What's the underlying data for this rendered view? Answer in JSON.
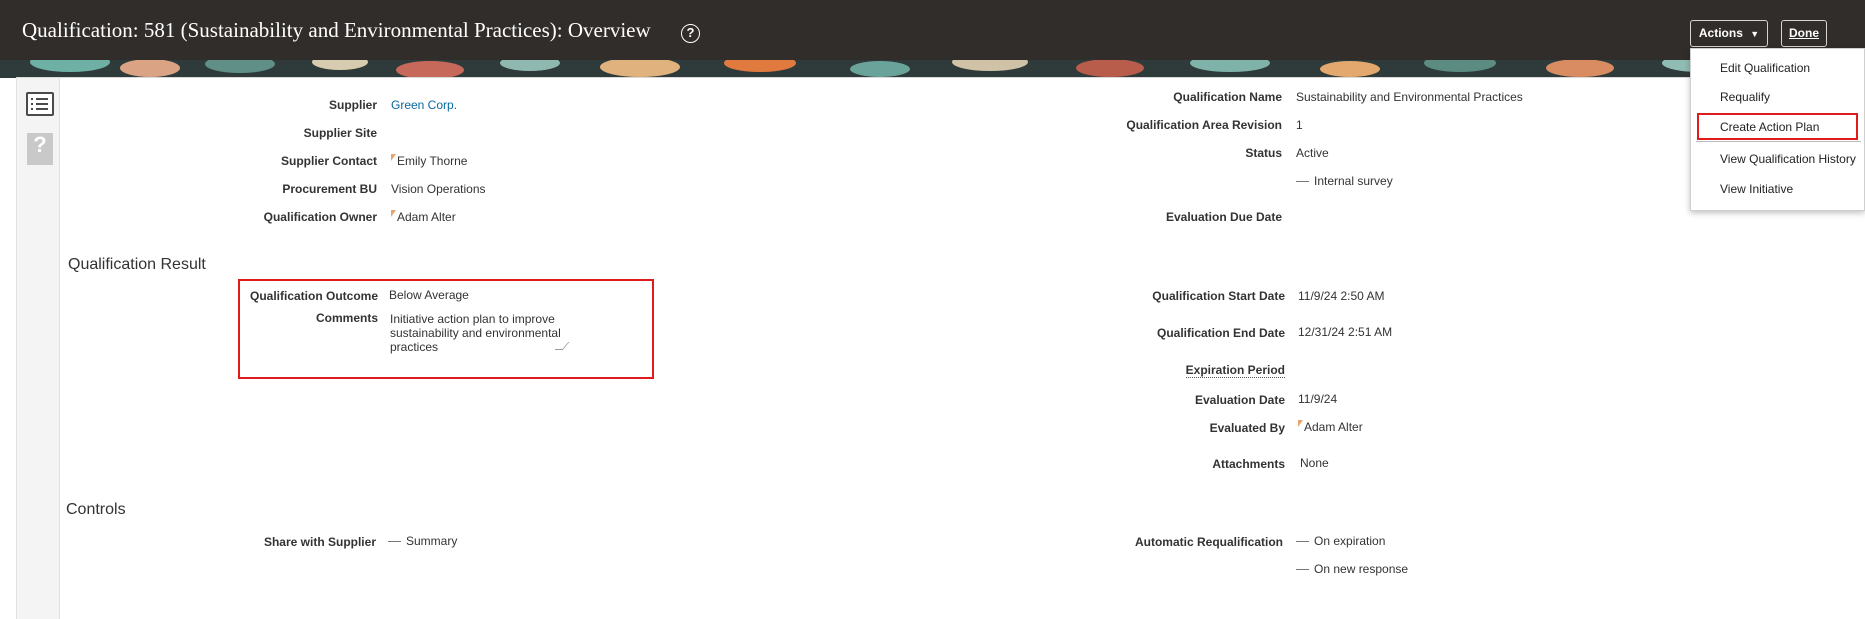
{
  "header": {
    "title": "Qualification: 581 (Sustainability and Environmental Practices): Overview",
    "help_icon": "help-circle-icon",
    "actions_label": "Actions",
    "done_label": "Done"
  },
  "actions_menu": {
    "items": [
      "Edit Qualification",
      "Requalify",
      "Create Action Plan",
      "View Qualification History",
      "View Initiative"
    ],
    "highlighted": "Create Action Plan"
  },
  "left_fields": {
    "supplier": {
      "label": "Supplier",
      "value": "Green Corp."
    },
    "supplier_site": {
      "label": "Supplier Site",
      "value": ""
    },
    "supplier_contact": {
      "label": "Supplier Contact",
      "value": "Emily Thorne"
    },
    "procurement_bu": {
      "label": "Procurement BU",
      "value": "Vision Operations"
    },
    "qualification_owner": {
      "label": "Qualification Owner",
      "value": "Adam Alter"
    }
  },
  "right_fields": {
    "qualification_name": {
      "label": "Qualification Name",
      "value": "Sustainability and Environmental Practices"
    },
    "area_revision": {
      "label": "Qualification Area Revision",
      "value": "1"
    },
    "status": {
      "label": "Status",
      "value": "Active"
    },
    "internal_survey": "Internal survey",
    "evaluation_due_date": {
      "label": "Evaluation Due Date",
      "value": ""
    }
  },
  "result": {
    "section_title": "Qualification Result",
    "outcome": {
      "label": "Qualification Outcome",
      "value": "Below Average"
    },
    "comments": {
      "label": "Comments",
      "value": "Initiative action plan to improve sustainability and environmental practices"
    },
    "start_date": {
      "label": "Qualification Start Date",
      "value": "11/9/24 2:50 AM"
    },
    "end_date": {
      "label": "Qualification End Date",
      "value": "12/31/24 2:51 AM"
    },
    "expiration_period": {
      "label": "Expiration Period",
      "value": ""
    },
    "evaluation_date": {
      "label": "Evaluation Date",
      "value": "11/9/24"
    },
    "evaluated_by": {
      "label": "Evaluated By",
      "value": "Adam Alter"
    },
    "attachments": {
      "label": "Attachments",
      "value": "None"
    }
  },
  "controls": {
    "section_title": "Controls",
    "share_with_supplier": {
      "label": "Share with Supplier",
      "value": "Summary"
    },
    "automatic_requalification": {
      "label": "Automatic Requalification",
      "values": [
        "On expiration",
        "On new response"
      ]
    }
  },
  "colors": {
    "header_bg": "#312d2a",
    "link": "#0a6a9c",
    "highlight_border": "#e01b1b"
  }
}
